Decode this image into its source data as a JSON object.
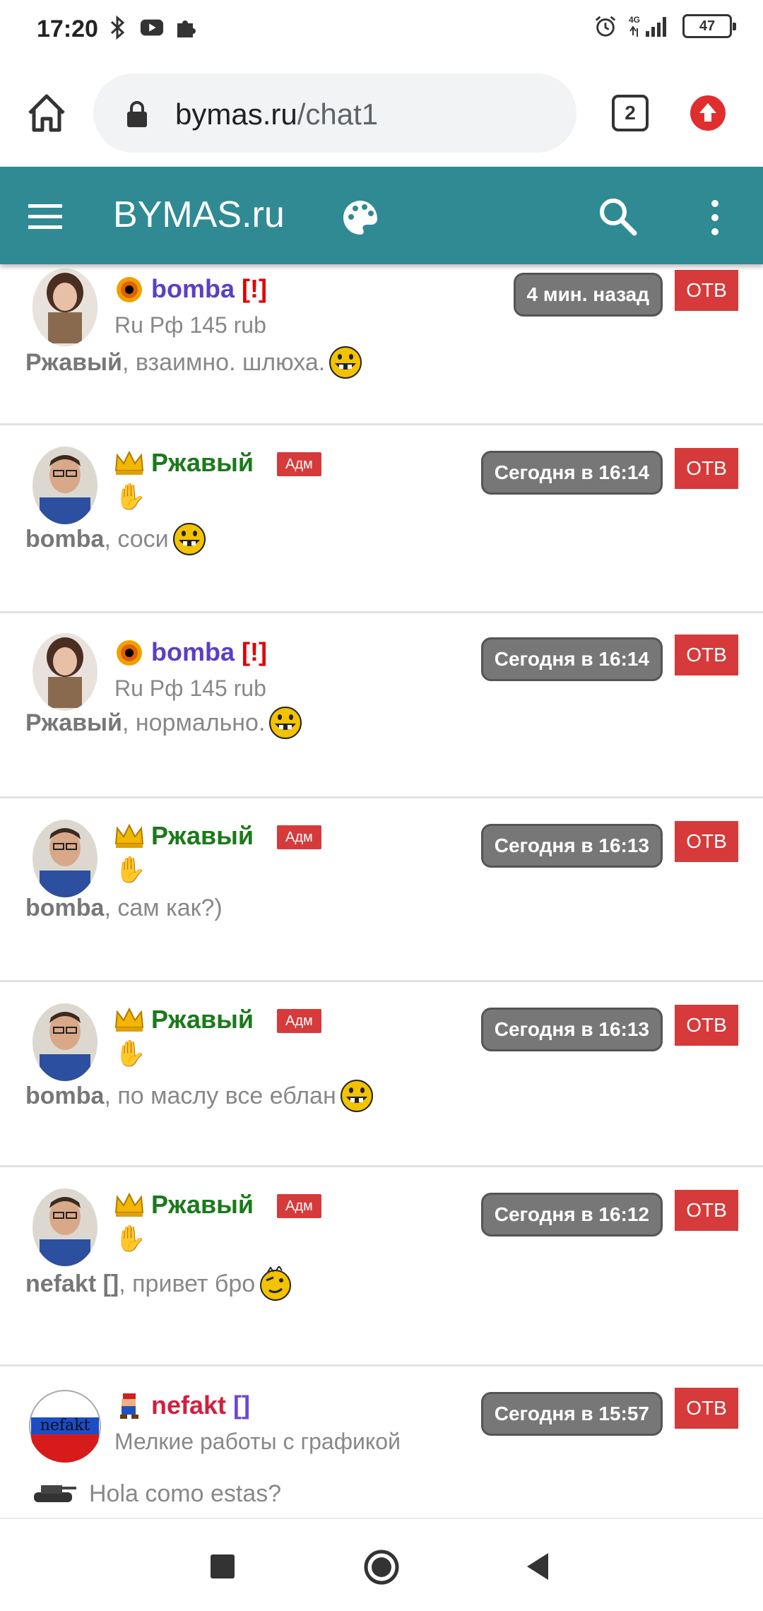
{
  "status_bar": {
    "time": "17:20",
    "network": "4G",
    "battery": "47",
    "icons_left": [
      "bluetooth-icon",
      "youtube-icon",
      "puzzle-icon"
    ],
    "icons_right": [
      "alarm-icon",
      "signal-icon",
      "battery-icon"
    ]
  },
  "browser": {
    "url_host": "bymas.ru",
    "url_path": "/chat1",
    "tab_count": "2"
  },
  "site": {
    "title": "BYMAS.ru",
    "header_color": "#2f8a93"
  },
  "messages": [
    {
      "user": "bomba",
      "flag": "[!]",
      "status": "Ru Рф 145 rub",
      "time": "4 мин. назад",
      "reply": "ОТВ",
      "addressee": "Ржавый",
      "text": ", взаимно. шлюха. ",
      "smile": "grin"
    },
    {
      "user": "Ржавый",
      "badge": "Адм",
      "hand": "✋",
      "time": "Сегодня в 16:14",
      "reply": "ОТВ",
      "addressee": "bomba",
      "text": ", соси",
      "smile": "grin"
    },
    {
      "user": "bomba",
      "flag": "[!]",
      "status": "Ru Рф 145 rub",
      "time": "Сегодня в 16:14",
      "reply": "ОТВ",
      "addressee": "Ржавый",
      "text": ", нормально. ",
      "smile": "grin"
    },
    {
      "user": "Ржавый",
      "badge": "Адм",
      "hand": "✋",
      "time": "Сегодня в 16:13",
      "reply": "ОТВ",
      "addressee": "bomba",
      "text": ", сам как?)",
      "smile": ""
    },
    {
      "user": "Ржавый",
      "badge": "Адм",
      "hand": "✋",
      "time": "Сегодня в 16:13",
      "reply": "ОТВ",
      "addressee": "bomba",
      "text": ", по маслу все еблан",
      "smile": "grin"
    },
    {
      "user": "Ржавый",
      "badge": "Адм",
      "hand": "✋",
      "time": "Сегодня в 16:12",
      "reply": "ОТВ",
      "addressee": "nefakt []",
      "text": ", привет бро",
      "smile": "wink"
    },
    {
      "user": "nefakt",
      "flag": "[]",
      "status": "Мелкие работы с графикой",
      "time": "Сегодня в 15:57",
      "reply": "ОТВ",
      "addressee": "",
      "text": "Hola como estas?",
      "smile": ""
    }
  ]
}
